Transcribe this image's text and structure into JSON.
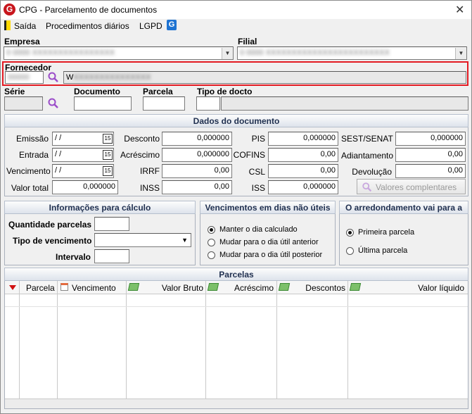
{
  "window": {
    "title": "CPG - Parcelamento de documentos",
    "app_icon": "G",
    "close_glyph": "✕"
  },
  "menu": {
    "items": [
      "Saída",
      "Procedimentos diários",
      "LGPD"
    ]
  },
  "header": {
    "empresa_label": "Empresa",
    "empresa_value": "0",
    "filial_label": "Filial",
    "filial_value": "0",
    "fornecedor_label": "Fornecedor",
    "fornecedor_code": "0",
    "fornecedor_name": "W",
    "serie_label": "Série",
    "documento_label": "Documento",
    "parcela_label": "Parcela",
    "tipo_docto_label": "Tipo de docto"
  },
  "dados_documento": {
    "title": "Dados do documento",
    "emissao_label": "Emissão",
    "emissao_value": " /  /",
    "entrada_label": "Entrada",
    "entrada_value": " /  /",
    "vencimento_label": "Vencimento",
    "vencimento_value": " /  /",
    "valor_total_label": "Valor total",
    "valor_total_value": "0,000000",
    "desconto_label": "Desconto",
    "desconto_value": "0,000000",
    "acrescimo_label": "Acréscimo",
    "acrescimo_value": "0,000000",
    "irrf_label": "IRRF",
    "irrf_value": "0,00",
    "inss_label": "INSS",
    "inss_value": "0,00",
    "pis_label": "PIS",
    "pis_value": "0,000000",
    "cofins_label": "COFINS",
    "cofins_value": "0,00",
    "csl_label": "CSL",
    "csl_value": "0,00",
    "iss_label": "ISS",
    "iss_value": "0,000000",
    "sest_label": "SEST/SENAT",
    "sest_value": "0,000000",
    "adiantamento_label": "Adiantamento",
    "adiantamento_value": "0,00",
    "devolucao_label": "Devolução",
    "devolucao_value": "0,00",
    "valores_button": "Valores complentares",
    "cal_glyph": "15"
  },
  "calculo": {
    "title": "Informações para cálculo",
    "quantidade_label": "Quantidade parcelas",
    "tipo_label": "Tipo de vencimento",
    "intervalo_label": "Intervalo"
  },
  "vencimentos": {
    "title": "Vencimentos em dias não úteis",
    "options": [
      "Manter o dia calculado",
      "Mudar para o dia útil anterior",
      "Mudar para o dia útil posterior"
    ],
    "selected": 0
  },
  "arredondamento": {
    "title": "O arredondamento vai para a",
    "options": [
      "Primeira parcela",
      "Última parcela"
    ],
    "selected": 0
  },
  "parcelas": {
    "title": "Parcelas",
    "columns": [
      "Parcela",
      "Vencimento",
      "Valor Bruto",
      "Acréscimo",
      "Descontos",
      "Valor líquido"
    ]
  },
  "colors": {
    "highlight": "#e31b23",
    "section_header_text": "#1f2f4f",
    "link_blue": "#1e73d2"
  },
  "icons": {
    "search": "search-icon",
    "calendar": "calendar-icon",
    "money": "money-icon",
    "sort": "sort-down-icon"
  }
}
